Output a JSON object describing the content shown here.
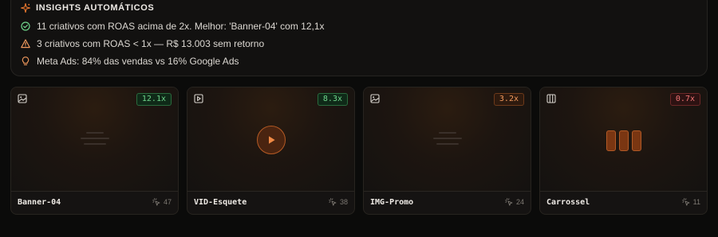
{
  "insights": {
    "title": "Insights automáticos",
    "items": [
      {
        "icon": "check-circle-icon",
        "text": "11 criativos com ROAS acima de 2x. Melhor: 'Banner-04' com 12,1x"
      },
      {
        "icon": "warning-triangle-icon",
        "text": "3 criativos com ROAS < 1x — R$ 13.003 sem retorno"
      },
      {
        "icon": "lightbulb-icon",
        "text": "Meta Ads: 84% das vendas vs 16% Google Ads"
      }
    ]
  },
  "creatives": [
    {
      "name": "Banner-04",
      "type": "image",
      "roas": "12.1x",
      "roas_level": "good",
      "count": "47"
    },
    {
      "name": "VID-Esquete",
      "type": "video",
      "roas": "8.3x",
      "roas_level": "good",
      "count": "38"
    },
    {
      "name": "IMG-Promo",
      "type": "image",
      "roas": "3.2x",
      "roas_level": "mid",
      "count": "24"
    },
    {
      "name": "Carrossel",
      "type": "carousel",
      "roas": "0.7x",
      "roas_level": "bad",
      "count": "11"
    }
  ],
  "colors": {
    "accent": "#e8772e",
    "good": "#6fd48b",
    "warning": "#f29a5d",
    "bad": "#ef7474"
  }
}
